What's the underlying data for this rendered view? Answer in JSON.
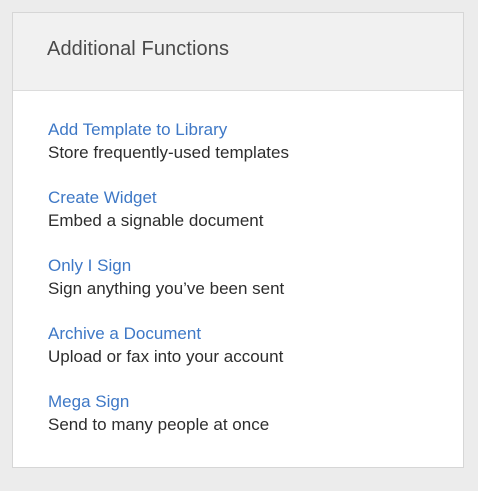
{
  "panel": {
    "title": "Additional Functions",
    "items": [
      {
        "label": "Add Template to Library",
        "description": "Store frequently-used templates"
      },
      {
        "label": "Create Widget",
        "description": "Embed a signable document"
      },
      {
        "label": "Only I Sign",
        "description": "Sign anything you’ve been sent"
      },
      {
        "label": "Archive a Document",
        "description": "Upload or fax into your account"
      },
      {
        "label": "Mega Sign",
        "description": "Send to many people at once"
      }
    ]
  },
  "colors": {
    "link": "#3e78c6",
    "text": "#2d2d2d",
    "header_bg": "#f1f1f1",
    "page_bg": "#ececec"
  }
}
